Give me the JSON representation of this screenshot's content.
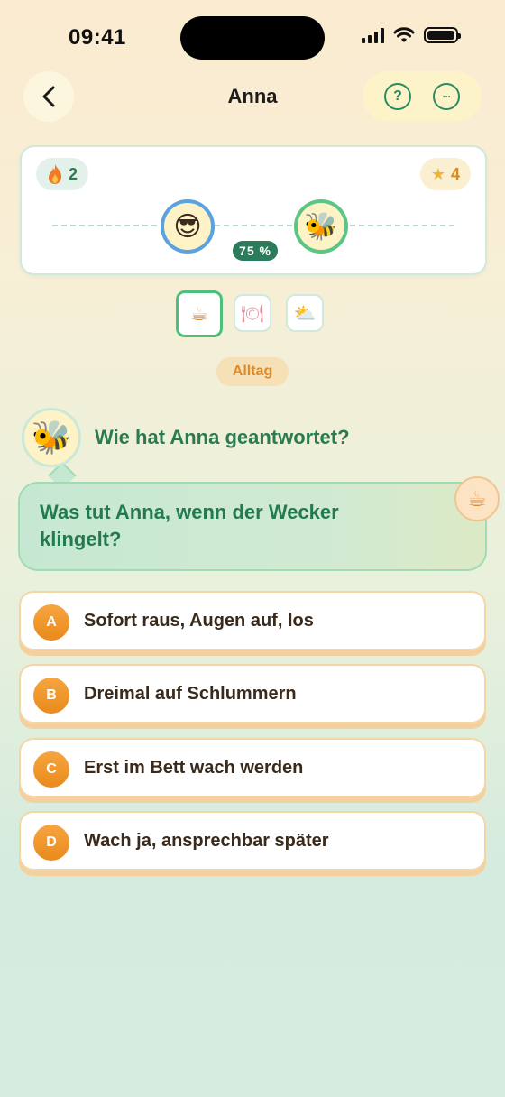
{
  "status_bar": {
    "time": "09:41"
  },
  "header": {
    "title": "Anna",
    "help_symbol": "?",
    "more_symbol": "···"
  },
  "progress": {
    "streak": "2",
    "stars": "4",
    "percent_label": "75 %",
    "percent_value": 75,
    "me_emoji": "😎",
    "partner_emoji": "🐝"
  },
  "categories": [
    {
      "icon": "coffee-icon",
      "glyph": "☕",
      "active": true
    },
    {
      "icon": "dining-icon",
      "glyph": "🍽",
      "active": false
    },
    {
      "icon": "weather-card-icon",
      "glyph": "⛅",
      "active": false
    }
  ],
  "chip": {
    "label": "Alltag"
  },
  "question": {
    "avatar_emoji": "🐝",
    "heading": "Wie hat Anna geantwortet?",
    "text": "Was tut Anna, wenn der Wecker klingelt?",
    "badge_glyph": "☕"
  },
  "options": [
    {
      "letter": "A",
      "text": "Sofort raus, Augen auf, los"
    },
    {
      "letter": "B",
      "text": "Dreimal auf Schlummern"
    },
    {
      "letter": "C",
      "text": "Erst im Bett wach werden"
    },
    {
      "letter": "D",
      "text": "Wach ja, ansprechbar später"
    }
  ],
  "colors": {
    "accent_green": "#2a7a52",
    "accent_orange": "#e98a1c",
    "avatar_me_ring": "#5ba3e0",
    "avatar_partner_ring": "#5cc585"
  }
}
